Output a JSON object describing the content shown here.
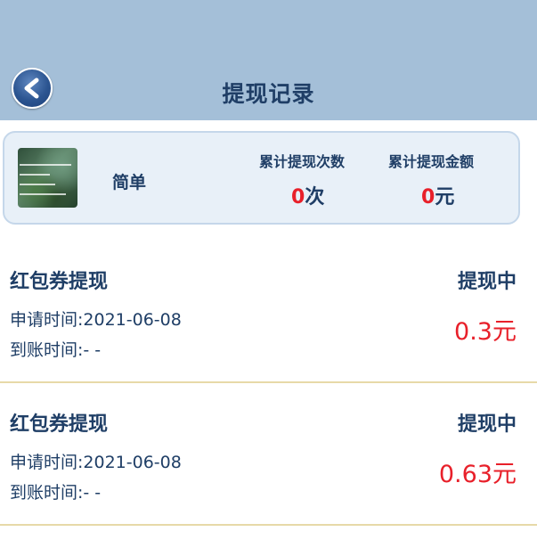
{
  "header": {
    "title": "提现记录"
  },
  "summary": {
    "username": "简单",
    "count_label": "累计提现次数",
    "count_value": "0",
    "count_unit": "次",
    "amount_label": "累计提现金额",
    "amount_value": "0",
    "amount_unit": "元"
  },
  "records": [
    {
      "type": "红包券提现",
      "status": "提现中",
      "apply_time": "申请时间:2021-06-08",
      "arrive_time": "到账时间:- -",
      "amount": "0.3元"
    },
    {
      "type": "红包券提现",
      "status": "提现中",
      "apply_time": "申请时间:2021-06-08",
      "arrive_time": "到账时间:- -",
      "amount": "0.63元"
    }
  ],
  "colors": {
    "header_bg": "#a4bfd8",
    "primary_text": "#1f3e66",
    "accent_red": "#e8202a",
    "card_bg": "#e8f0f8"
  }
}
